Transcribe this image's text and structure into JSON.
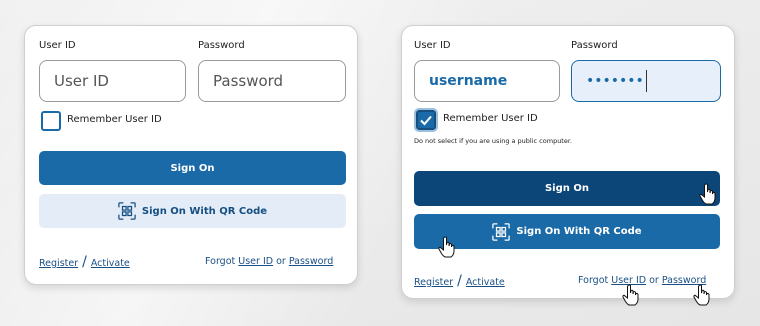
{
  "left_card": {
    "user_id_label": "User ID",
    "password_label": "Password",
    "user_id_placeholder": "User ID",
    "password_placeholder": "Password",
    "remember_label": "Remember User ID",
    "sign_on_label": "Sign On",
    "qr_label": "Sign On With QR Code",
    "register_label": "Register",
    "slash": "/",
    "activate_label": "Activate",
    "forgot_label": "Forgot",
    "forgot_user_id_label": "User ID",
    "or_label": "or",
    "forgot_password_label": "Password"
  },
  "right_card": {
    "user_id_label": "User ID",
    "password_label": "Password",
    "user_id_value": "username",
    "password_value": "•••••••",
    "remember_label": "Remember User ID",
    "remember_checked": true,
    "public_note": "Do not select if you are using a public computer.",
    "sign_on_label": "Sign On",
    "qr_label": "Sign On With QR Code",
    "register_label": "Register",
    "slash": "/",
    "activate_label": "Activate",
    "forgot_label": "Forgot",
    "forgot_user_id_label": "User ID",
    "or_label": "or",
    "forgot_password_label": "Password"
  },
  "icons": {
    "qr": "qr-code-icon",
    "check": "checkmark-icon",
    "cursor": "hand-pointer-cursor-icon"
  },
  "colors": {
    "primary": "#1a6aa8",
    "primary_hover": "#0c4679",
    "qr_bg": "#e4edf7",
    "link": "#1a4f86",
    "input_active_bg": "#e7f0fa"
  }
}
